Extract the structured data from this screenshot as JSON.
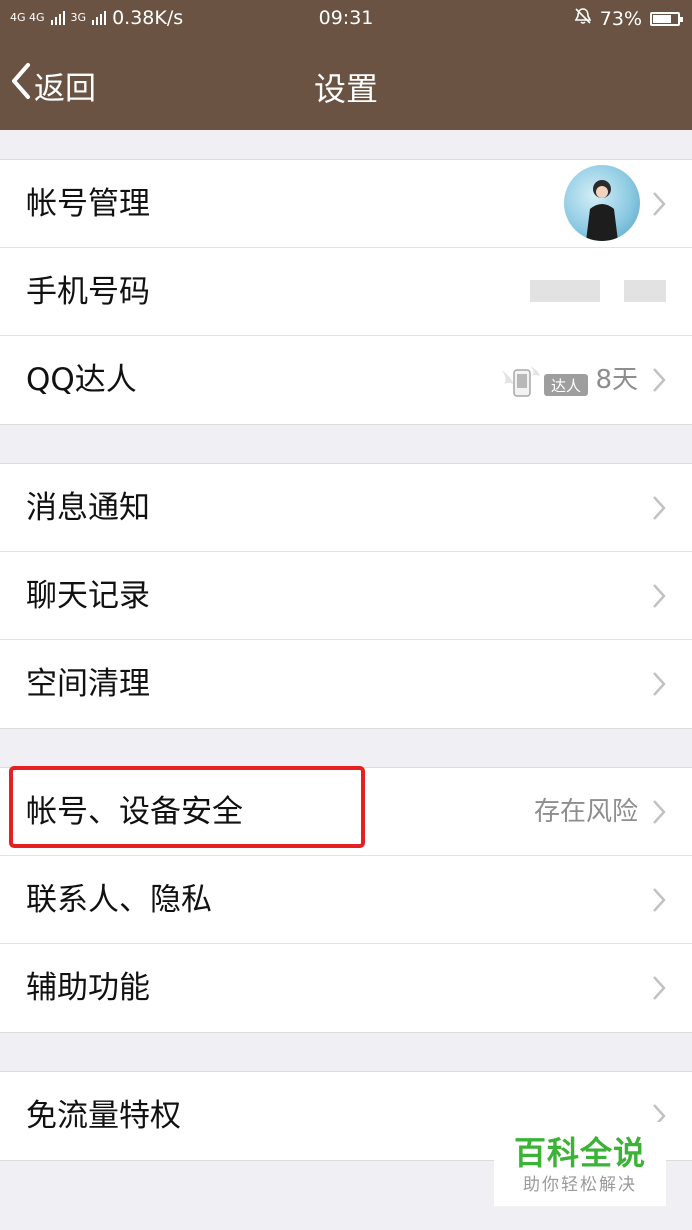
{
  "status_bar": {
    "signal1": "4G 4G",
    "signal2": "3G",
    "speed": "0.38K/s",
    "time": "09:31",
    "battery": "73%",
    "battery_level": 0.73
  },
  "nav": {
    "back_label": "返回",
    "title": "设置"
  },
  "groups": [
    {
      "items": [
        {
          "label": "帐号管理",
          "accessory": "avatar"
        },
        {
          "label": "手机号码",
          "accessory": "blurred-phone-number"
        },
        {
          "label": "QQ达人",
          "badge_text": "达人",
          "detail": "8天"
        }
      ]
    },
    {
      "items": [
        {
          "label": "消息通知"
        },
        {
          "label": "聊天记录"
        },
        {
          "label": "空间清理"
        }
      ]
    },
    {
      "items": [
        {
          "label": "帐号、设备安全",
          "detail": "存在风险",
          "highlighted": true,
          "highlight_color": "#e51f22"
        },
        {
          "label": "联系人、隐私"
        },
        {
          "label": "辅助功能"
        }
      ]
    },
    {
      "items": [
        {
          "label": "免流量特权"
        }
      ]
    }
  ],
  "watermark": {
    "main": "百科全说",
    "sub": "助你轻松解决"
  },
  "colors": {
    "header": "#6b5344",
    "background": "#efeff4",
    "watermark_green": "#3cb337",
    "highlight": "#e51f22"
  }
}
